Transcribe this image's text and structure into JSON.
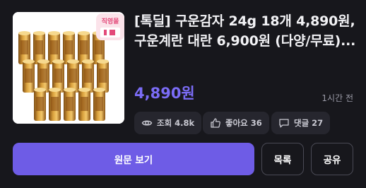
{
  "deal": {
    "title": "[톡딜] 구운감자 24g 18개 4,890원, 구운계란 대란 6,900원 (다양/무료)...",
    "price": "4,890원",
    "posted": "1시간 전",
    "thumbnail_badge": "직영몰"
  },
  "stats": {
    "views": "조회 4.8k",
    "likes": "좋아요 36",
    "comments": "댓글 27"
  },
  "actions": {
    "view_original": "원문 보기",
    "list": "목록",
    "share": "공유"
  },
  "colors": {
    "background": "#17171c",
    "accent": "#6e5ce6",
    "price": "#7b6cf6",
    "chip": "#26262e"
  },
  "icons": [
    "eye-icon",
    "thumbs-up-icon",
    "comment-icon"
  ]
}
